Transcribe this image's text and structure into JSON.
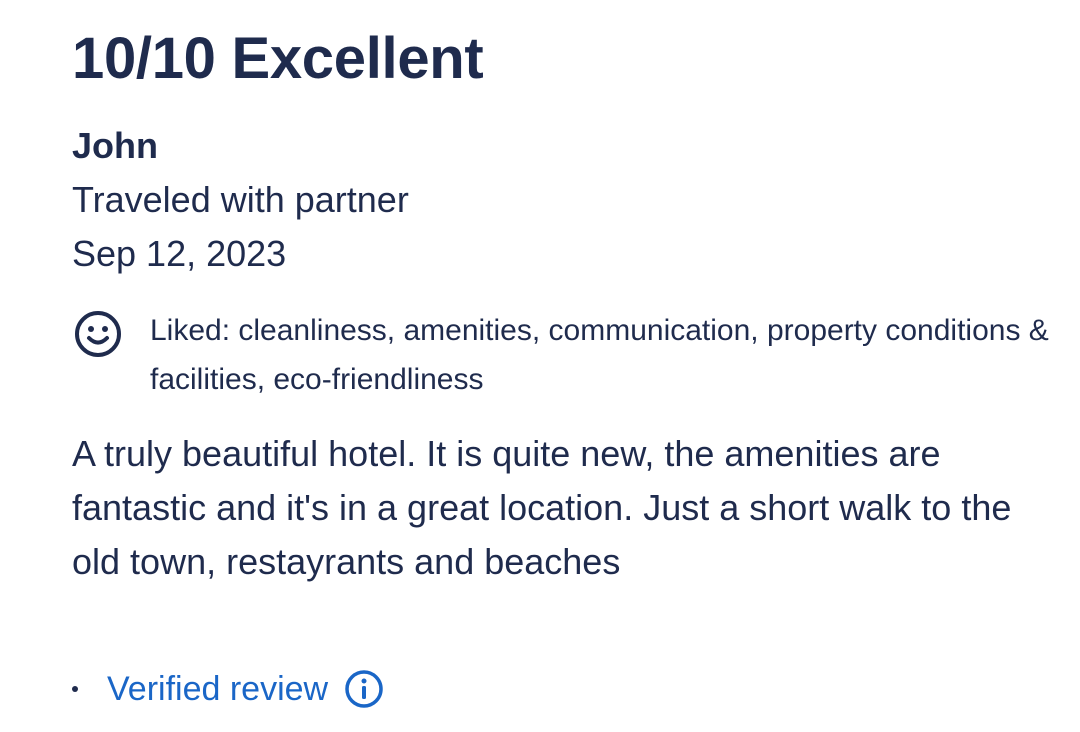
{
  "review": {
    "rating_title": "10/10 Excellent",
    "author": "John",
    "traveler_type": "Traveled with partner",
    "date": "Sep 12, 2023",
    "liked_icon": "smile-icon",
    "liked_text": "Liked: cleanliness, amenities, communication, property conditions & facilities, eco-friendliness",
    "body": "A truly beautiful hotel. It is quite new, the amenities are fantastic and it's in a great location. Just a short walk to the old town, restayrants and beaches",
    "verified_label": "Verified review",
    "verified_icon": "info-icon"
  },
  "colors": {
    "text": "#1f2b4d",
    "link": "#1a66c7",
    "background": "#ffffff"
  }
}
